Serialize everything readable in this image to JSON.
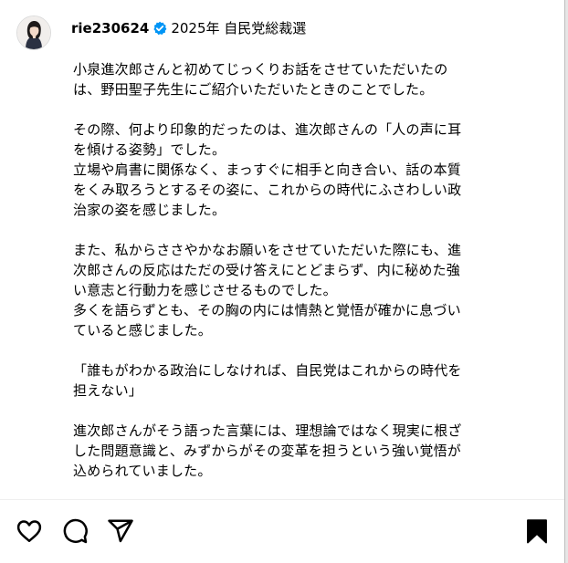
{
  "post": {
    "username": "rie230624",
    "caption_head": "2025年 自民党総裁選"
  },
  "caption": {
    "paragraphs": [
      {
        "lines": [
          "小泉進次郎さんと初めてじっくりお話をさせていただいたの",
          "は、野田聖子先生にご紹介いただいたときのことでした。"
        ]
      },
      {
        "lines": [
          "その際、何より印象的だったのは、進次郎さんの「人の声に耳",
          "を傾ける姿勢」でした。",
          "立場や肩書に関係なく、まっすぐに相手と向き合い、話の本質",
          "をくみ取ろうとするその姿に、これからの時代にふさわしい政",
          "治家の姿を感じました。"
        ]
      },
      {
        "lines": [
          "また、私からささやかなお願いをさせていただいた際にも、進",
          "次郎さんの反応はただの受け答えにとどまらず、内に秘めた強",
          "い意志と行動力を感じさせるものでした。",
          "多くを語らずとも、その胸の内には情熱と覚悟が確かに息づい",
          "ていると感じました。"
        ]
      },
      {
        "lines": [
          "「誰もがわかる政治にしなければ、自民党はこれからの時代を",
          "担えない」"
        ]
      },
      {
        "lines": [
          "進次郎さんがそう語った言葉には、理想論ではなく現実に根ざ",
          "した問題意識と、みずからがその変革を担うという強い覚悟が",
          "込められていました。"
        ]
      }
    ]
  },
  "actions": {
    "like": "heart-icon",
    "comment": "comment-bubble-icon",
    "share": "paper-plane-icon",
    "save": "bookmark-icon"
  },
  "colors": {
    "verified_badge": "#0095f6",
    "text": "#000000",
    "divider": "#efefef"
  }
}
